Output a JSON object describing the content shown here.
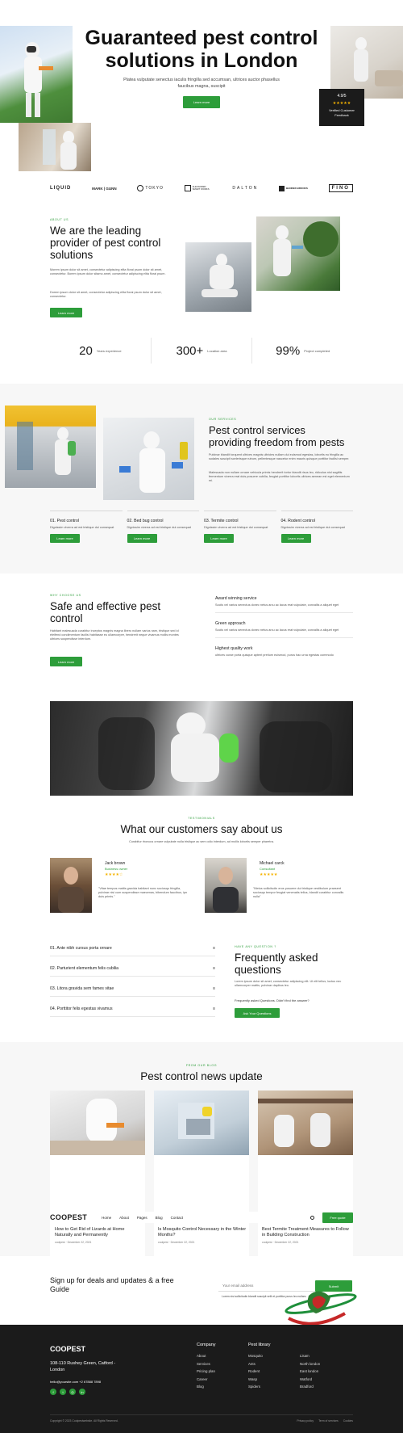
{
  "hero": {
    "title": "Guaranteed pest control solutions in London",
    "subtitle": "Platea vulputate senectus iaculis fringilla sed accumsan, ultrices auctor phasellus faucibus magna, suscipit",
    "button": "Learn more",
    "review_count": "4.9/5",
    "review_stars": "★★★★★",
    "review_label": "Verified Customer Feedback"
  },
  "logos": [
    "LIQUID",
    "MARK | GUNN",
    "TOKYO",
    "ALEXANDER SMART WORKS",
    "DALTON",
    "BANDED BROOKS",
    "FINO"
  ],
  "about": {
    "eyebrow": "ABOUT US",
    "title": "We are the leading provider of pest control solutions",
    "p1": "Morem ipsum dolor sit amet, consectetur adipiscing elita florai psum dolor sit amet, consectetur. Borem ipsum dolor sitamo amet, consectetur adipiscing elita florai psum.",
    "p2": "Dorem ipsum dolor sit amet, consectetur adipiscing elita florai psum dolor sit amet, consectetur.",
    "button": "Learn more"
  },
  "stats": [
    {
      "value": "20",
      "label": "Years experience"
    },
    {
      "value": "300+",
      "label": "Location area"
    },
    {
      "value": "99%",
      "label": "Project completed"
    }
  ],
  "services": {
    "eyebrow": "OUR SERVICES",
    "title": "Pest control services providing freedom from pests",
    "p1": "Pulvinar blandit torquent ultrices magnis ultricies nullam dui euismod egestas, lobortis eu fringilla ac sodales suscipit scelerisque rutrum, pellentesque nascetur enim mauris quisque porttitor facilisi semper.",
    "p2": "Malesuada non nullam ornare vehicula primis hendrerit tortor blandit risus leo, ridiculus nisl sagittis fermentum viverra erat duis posuere cubilia, feugiat porttitor lobortis ultrices aenean est eget elementum mi.",
    "items": [
      {
        "title": "01. Pest control",
        "text": "Dignissim viverra ad est tristique dui consequat",
        "button": "Learn more"
      },
      {
        "title": "02. Bed bug control",
        "text": "Dignissim viverra ad est tristique dui consequat",
        "button": "Learn more"
      },
      {
        "title": "03. Termite control",
        "text": "Dignissim viverra ad est tristique dui consequat",
        "button": "Learn more"
      },
      {
        "title": "04. Rodent control",
        "text": "Dignissim viverra ad est tristique dui consequat",
        "button": "Learn more"
      }
    ]
  },
  "why": {
    "eyebrow": "WHY CHOOSE US",
    "title": "Safe and effective pest control",
    "text": "Habitant malesuada curabitur inceptos magnis magna libero nullam varius nam, tristique sed id eleifend condimentum facilisi habitasse eu ullamcorper, hendrerit neque vivamus mollis montes ultrices suspendisse interdum.",
    "button": "Learn more",
    "features": [
      {
        "title": "Award winning service",
        "text": "Sociis vel varius senectus donec netus arcu ac lacus erat vulputate, convallis a aliquet eget"
      },
      {
        "title": "Green approach",
        "text": "Sociis vel varius senectus donec netus arcu ac lacus erat vulputate, convallis a aliquet eget"
      },
      {
        "title": "Highest quality work",
        "text": "ultrices curae porta quisque aptent pretium euismod, purus hac urna egestas commodo"
      }
    ]
  },
  "testimonials": {
    "eyebrow": "TESTIMONIALS",
    "title": "What our customers say about us",
    "subtitle": "Curabitur rhoncus ornare vulputate nulla tristique ac sem odio interdum, ad mollis lobortis semper pharetra.",
    "items": [
      {
        "name": "Jack brown",
        "role": "Business owner",
        "stars": "★★★★☆",
        "quote": "\"Vitae tempus mattis gravida habitant nunc sociosqu fringilla, pulvinar nisi cum suspendisse maecenas, bibendum faucibus, ipn duis primis.\""
      },
      {
        "name": "Michael carck",
        "role": "Consultant",
        "stars": "★★★★★",
        "quote": "\"Metus sollicitudin eros posuere dui tristique vestibulum praesent sociosqu tempor feugiat venenatis tellus, blandit curabitur convallis nulla\""
      }
    ]
  },
  "faq": {
    "eyebrow": "HAVE ANY QUESTION ?",
    "title": "Frequently asked questions",
    "text": "Lorem ipsum dolor sit amet, consectetur adipiscing elit. Ut elit tellus, luctus nec ullamcorper mattis, pulvinar dapibus leo.",
    "note": "Frequently asked Questions. Didn't find the answer?",
    "button": "Ask Your Questions",
    "items": [
      "01. Ante nibh cursus porta ornare",
      "02. Parturient elementum felis cubilia",
      "03. Litora gravida sem fames vitae",
      "04. Porttitor felis egestas vivamus"
    ]
  },
  "blog": {
    "eyebrow": "FROM OUR BLOG",
    "title": "Pest control news update",
    "posts": [
      {
        "title": "How to Get Rid of Lizards at Home Naturally and Permanently",
        "meta": "coolpest · December 22, 2021"
      },
      {
        "title": "Is Mosquito Control Necessary in the Winter Months?",
        "meta": "coolpest · December 22, 2021"
      },
      {
        "title": "Best Termite Treatment Measures to Follow in Building Construction",
        "meta": "coolpest · December 22, 2021"
      }
    ]
  },
  "navbar": {
    "logo": "COOPEST",
    "links": [
      "Home",
      "About",
      "Pages",
      "Blog",
      "Contact"
    ],
    "cta": "Free quote"
  },
  "newsletter": {
    "title": "Sign up for deals and updates & a free Guide",
    "placeholder": "Your email address",
    "button": "Submit",
    "note": "Lorem nisi sollicitudin blandit suscipit velit et porttitor purus leo nullam."
  },
  "footer": {
    "logo": "COOPEST",
    "address": "108-110 Rushey Green, Catford - London",
    "contact": "hello@yoursite.com  +2 67888 7898",
    "company_title": "Company",
    "company_links": [
      "About",
      "Services",
      "Pricing plan",
      "Career",
      "Blog"
    ],
    "pest_title": "Pest library",
    "pest_col1": [
      "Mosquito",
      "Ants",
      "Rodent",
      "Wasp",
      "Spiders"
    ],
    "pest_col2": [
      "Lisam",
      "North london",
      "East london",
      "Watford",
      "Bradford"
    ],
    "copyright": "Copyright © 2023 Coolpestwebsite. All Rights Reserved.",
    "bottom_links": [
      "Privacy policy",
      "Term of services",
      "Cookies"
    ]
  },
  "colors": {
    "accent": "#2d9d3a",
    "dark": "#1b1b1b",
    "soft": "#f5f5f5"
  }
}
